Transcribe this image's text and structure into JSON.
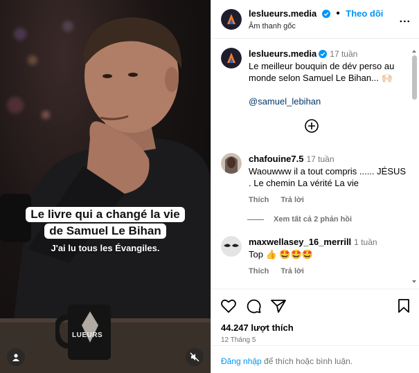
{
  "post": {
    "username": "leslueurs.media",
    "follow_label": "Theo dõi",
    "audio_label": "Âm thanh gốc",
    "more_label": "...",
    "caption_time": "17 tuần",
    "caption_text": "Le meilleur bouquin de dév perso au monde selon Samuel Le Bihan... 🙌🏻",
    "mention": "@samuel_lebihan"
  },
  "video": {
    "caption_line1": "Le livre qui a changé la vie",
    "caption_line2": "de Samuel Le Bihan",
    "caption_line3": "J'ai lu tous les Évangiles.",
    "mug_label": "LUEURS"
  },
  "comments": [
    {
      "username": "chafouine7.5",
      "time": "17 tuần",
      "text": "Waouwww il a tout compris ...... JÉSUS . Le chemin La vérité La vie",
      "like_label": "Thích",
      "reply_label": "Trả lời"
    },
    {
      "username": "maxwellasey_16_merrill",
      "time": "1 tuần",
      "text": "Top 👍 🤩🤩🤩",
      "like_label": "Thích",
      "reply_label": "Trả lời"
    }
  ],
  "view_replies": "Xem tất cả 2 phản hồi",
  "stats": {
    "likes": "44.247 lượt thích",
    "date": "12 Tháng 5"
  },
  "footer": {
    "login_link": "Đăng nhập",
    "login_text": " để thích hoặc bình luận."
  },
  "colors": {
    "accent": "#0095f6",
    "verified": "#0095f6",
    "muted": "#737373"
  },
  "icons": [
    "user-icon",
    "mute-icon",
    "verified-icon",
    "add-circle-icon",
    "heart-icon",
    "comment-icon",
    "share-icon",
    "bookmark-icon"
  ]
}
